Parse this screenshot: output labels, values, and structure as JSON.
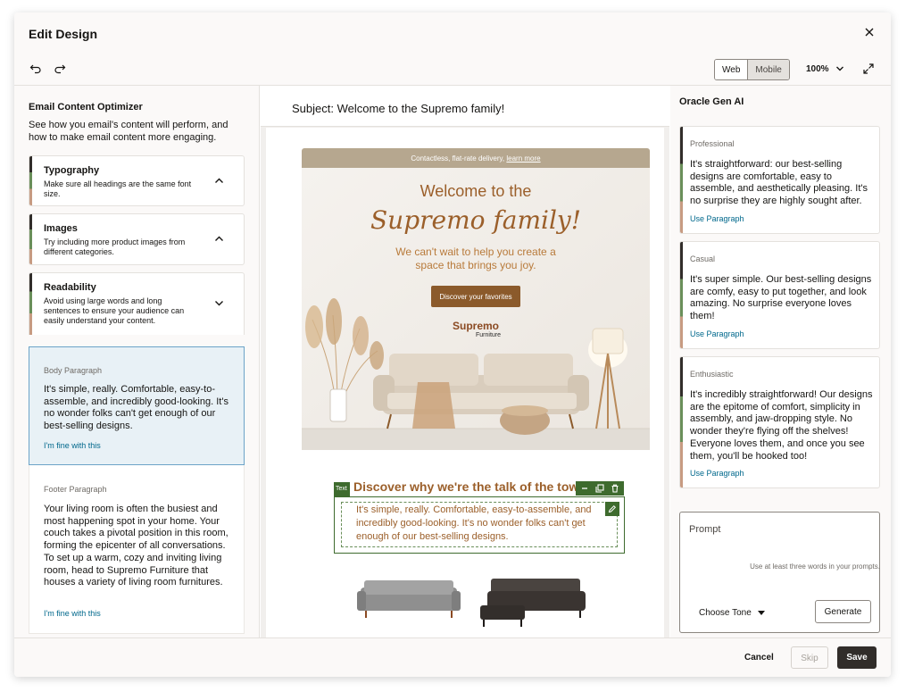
{
  "dialog": {
    "title": "Edit Design"
  },
  "toolbar": {
    "view_web": "Web",
    "view_mobile": "Mobile",
    "zoom": "100%"
  },
  "optimizer": {
    "title": "Email Content Optimizer",
    "description": "See how you email's content will perform, and how to make email content more engaging.",
    "cards": [
      {
        "title": "Typography",
        "description": "Make sure all headings are the same font size."
      },
      {
        "title": "Images",
        "description": "Try including more product images from different categories."
      },
      {
        "title": "Readability",
        "description": "Avoid using large words and long sentences to ensure your audience can easily understand your content."
      }
    ],
    "body_paragraph": {
      "label": "Body Paragraph",
      "text": "It's simple, really. Comfortable, easy-to-assemble, and incredibly good-looking. It's no wonder folks can't get enough of our best-selling designs.",
      "link": "I'm fine with this"
    },
    "footer_paragraph": {
      "label": "Footer Paragraph",
      "text": "Your living room is often the busiest and most happening spot in your home. Your couch takes a pivotal position in this room, forming the epicenter of all conversations. To set up a warm, cozy and inviting living room, head to Supremo Furniture that houses a variety of living room furnitures.",
      "link": "I'm fine with this"
    }
  },
  "email": {
    "subject": "Subject: Welcome to the Supremo family!",
    "banner_text": "Contactless, flat-rate delivery,",
    "banner_link": "learn more",
    "heading_line1": "Welcome to the",
    "heading_line2": "Supremo family!",
    "subheading": "We can't wait to help you create a space that brings you joy.",
    "cta": "Discover your favorites",
    "logo_name": "Supremo",
    "logo_sub": "Furniture",
    "selected_label": "Text",
    "section_title": "Discover why we're the talk of the town",
    "section_text": "It's simple, really. Comfortable, easy-to-assemble, and incredibly good-looking. It's no wonder folks can't get enough of our best-selling designs."
  },
  "gen_ai": {
    "title": "Oracle Gen AI",
    "suggestions": [
      {
        "tone": "Professional",
        "text": "It's straightforward: our best-selling designs are comfortable, easy to assemble, and aesthetically pleasing. It's no surprise they are highly sought after.",
        "action": "Use Paragraph"
      },
      {
        "tone": "Casual",
        "text": "It's super simple. Our best-selling designs are comfy, easy to put together, and look amazing. No surprise everyone loves them!",
        "action": "Use Paragraph"
      },
      {
        "tone": "Enthusiastic",
        "text": "It's incredibly straightforward! Our designs are the epitome of comfort, simplicity in assembly, and jaw-dropping style. No wonder they're flying off the shelves! Everyone loves them, and once you see them, you'll be hooked too!",
        "action": "Use Paragraph"
      }
    ],
    "prompt_placeholder": "Prompt",
    "tone_select": "Choose Tone",
    "generate": "Generate",
    "hint": "Use at least three words in your prompts."
  },
  "footer": {
    "cancel": "Cancel",
    "skip": "Skip",
    "save": "Save"
  },
  "colors": {
    "accent_green": "#3e6b2e",
    "brand_brown": "#9b5f2a",
    "link_blue": "#00688c",
    "selection_blue": "#e8f1f6",
    "save_dark": "#312d2a"
  }
}
